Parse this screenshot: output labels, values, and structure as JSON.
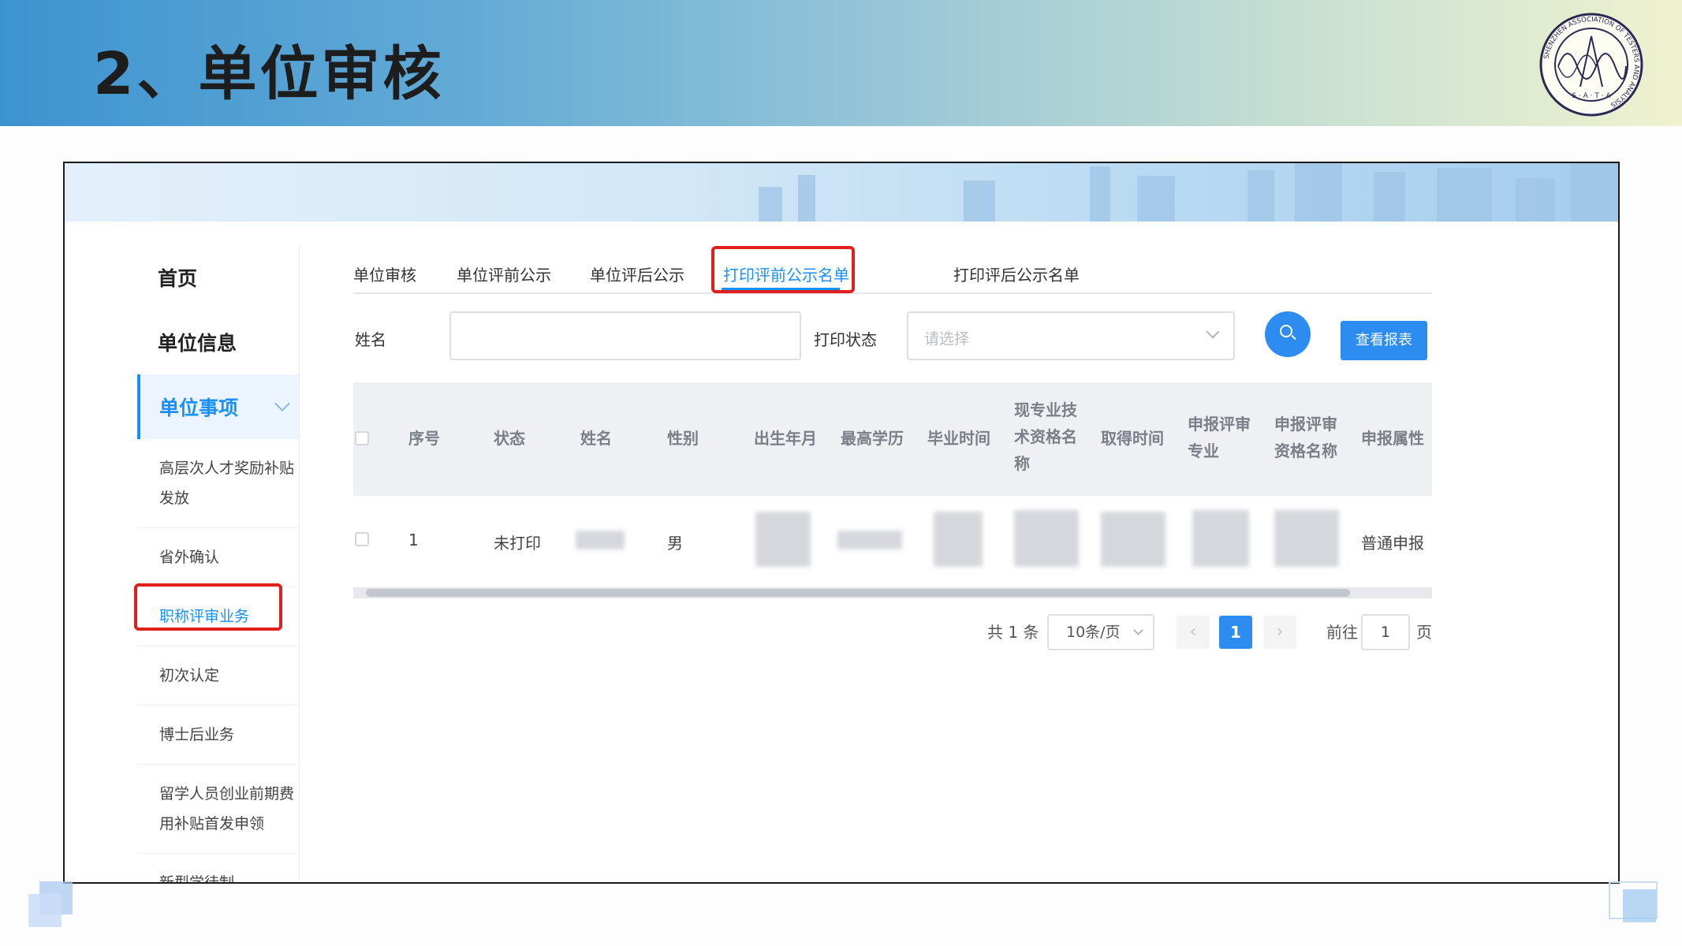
{
  "slide": {
    "title": "2、单位审核"
  },
  "logo": {
    "ring_text": "SHENZHEN ASSOCIATION OF TESTERS AND ANALYSIS",
    "letters": "S · A · T · A"
  },
  "sidebar": {
    "items": [
      {
        "label": "首页"
      },
      {
        "label": "单位信息"
      },
      {
        "label": "单位事项"
      }
    ],
    "subitems": [
      {
        "label": "高层次人才奖励补贴发放"
      },
      {
        "label": "省外确认"
      },
      {
        "label": "职称评审业务"
      },
      {
        "label": "初次认定"
      },
      {
        "label": "博士后业务"
      },
      {
        "label": "留学人员创业前期费用补贴首发申领"
      },
      {
        "label": "新型学徒制"
      }
    ]
  },
  "tabs": [
    {
      "label": "单位审核"
    },
    {
      "label": "单位评前公示"
    },
    {
      "label": "单位评后公示"
    },
    {
      "label": "打印评前公示名单"
    },
    {
      "label": "打印评后公示名单"
    }
  ],
  "filters": {
    "name_label": "姓名",
    "name_value": "",
    "status_label": "打印状态",
    "status_placeholder": "请选择",
    "report_button": "查看报表"
  },
  "table": {
    "headers": [
      "序号",
      "状态",
      "姓名",
      "性别",
      "出生年月",
      "最高学历",
      "毕业时间",
      "现专业技术资格名称",
      "取得时间",
      "申报评审专业",
      "申报评审资格名称",
      "申报属性"
    ],
    "rows": [
      {
        "index": "1",
        "status": "未打印",
        "gender": "男",
        "attribute": "普通申报"
      }
    ]
  },
  "pagination": {
    "total": "共 1 条",
    "page_size": "10条/页",
    "current_page": "1",
    "goto_label": "前往",
    "goto_value": "1",
    "page_suffix": "页"
  },
  "colors": {
    "accent": "#1890ff",
    "highlight_box": "#e0201e",
    "button": "#2d8cf0"
  }
}
